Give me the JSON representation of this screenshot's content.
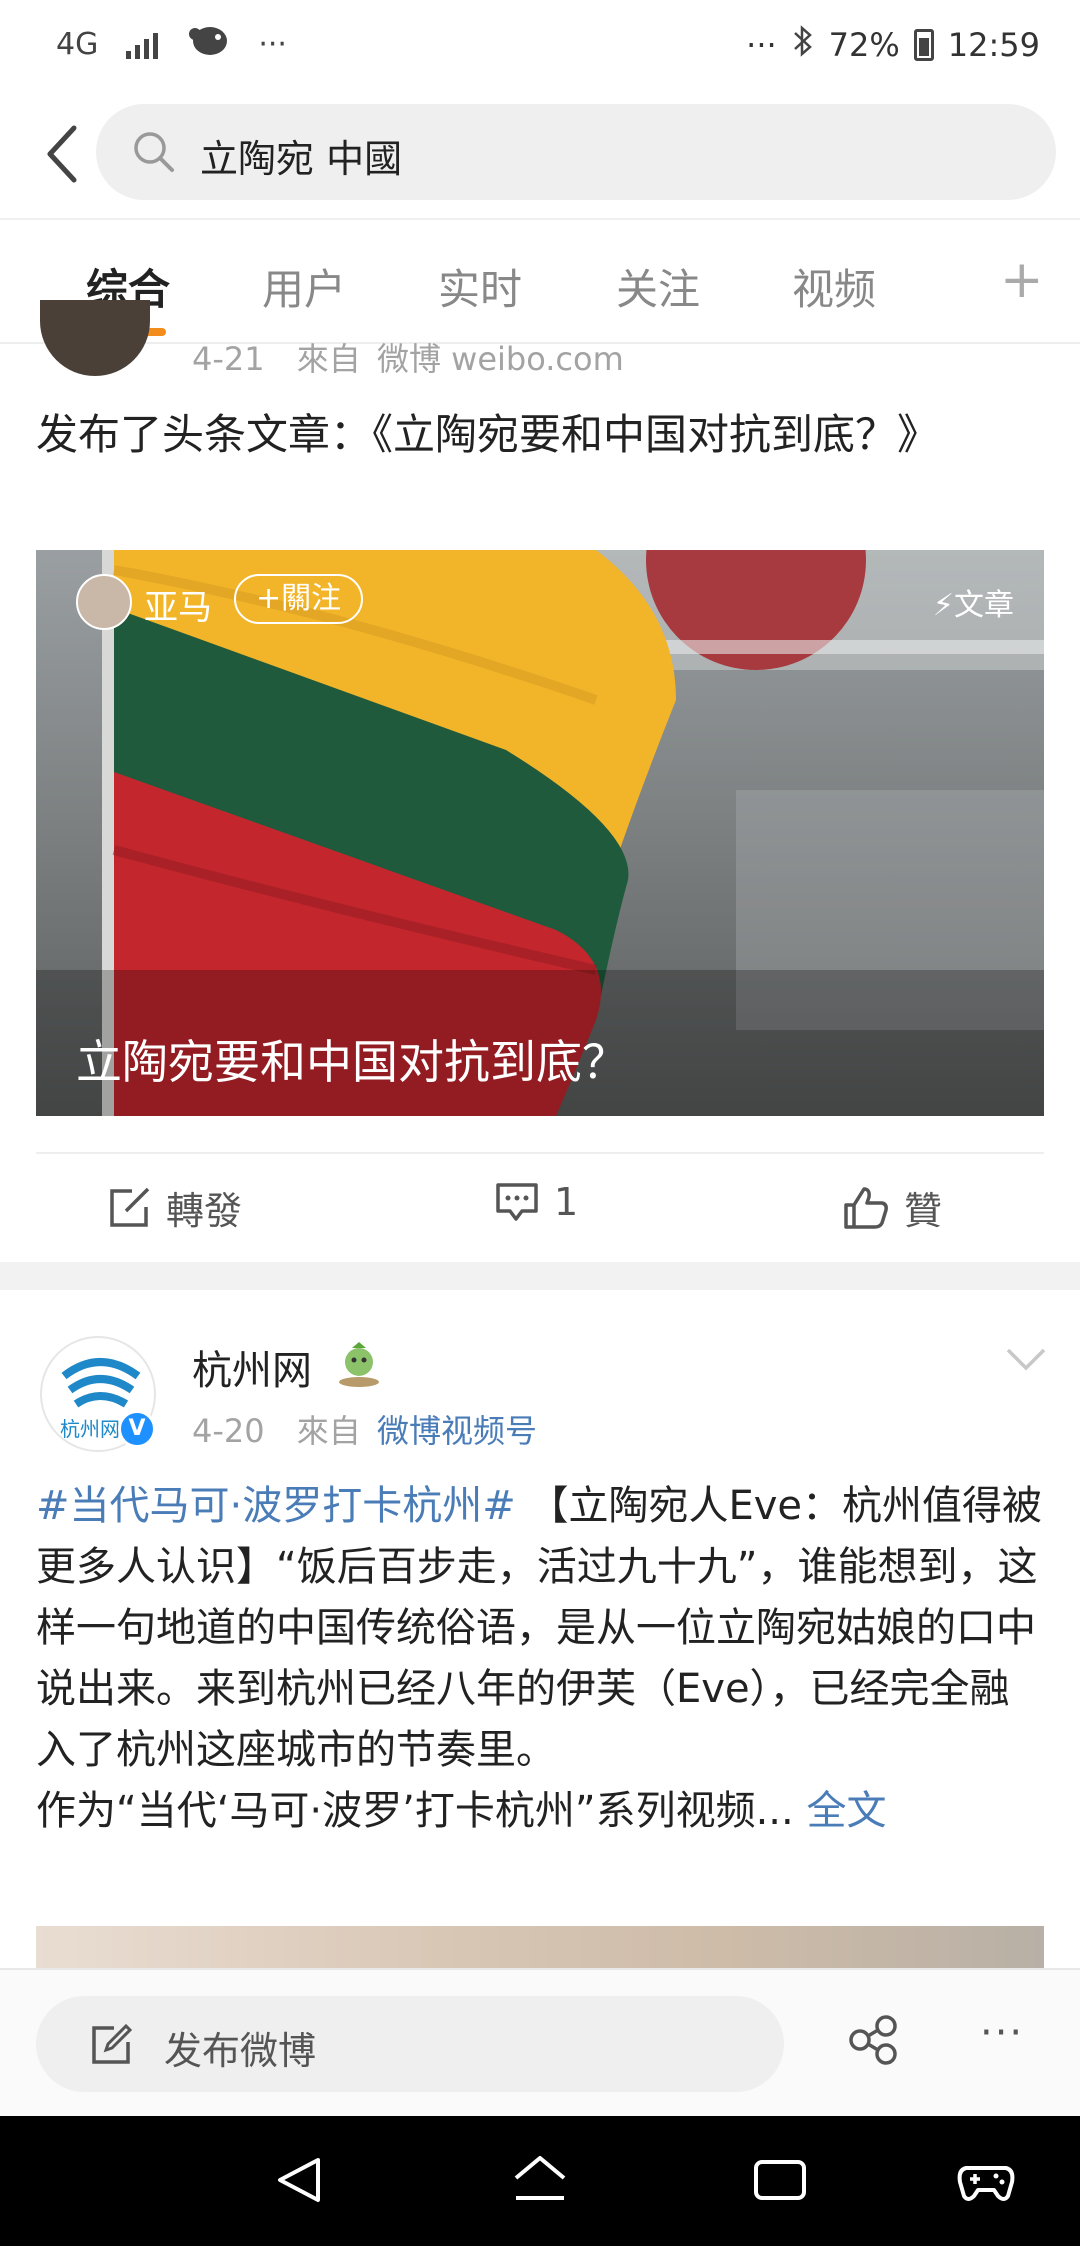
{
  "status_bar": {
    "network": "4G",
    "dots_left": "···",
    "dots_right": "···",
    "battery": "72%",
    "time": "12:59"
  },
  "search": {
    "query": "立陶宛 中國"
  },
  "tabs": [
    {
      "label": "综合",
      "active": true
    },
    {
      "label": "用户",
      "active": false
    },
    {
      "label": "实时",
      "active": false
    },
    {
      "label": "关注",
      "active": false
    },
    {
      "label": "视频",
      "active": false
    }
  ],
  "tab_more": "+",
  "post1": {
    "date": "4-21",
    "from": "來自",
    "source": "微博 weibo.com",
    "text": "发布了头条文章：《立陶宛要和中国对抗到底？》",
    "card": {
      "author": "亚马",
      "follow": "+關注",
      "type": "文章",
      "title": "立陶宛要和中国对抗到底？",
      "flag_colors": [
        "#f2b52a",
        "#1f5a3c",
        "#c3262c"
      ]
    },
    "actions": {
      "repost": "轉發",
      "comment_count": "1",
      "like": "贊"
    }
  },
  "post2": {
    "name": "杭州网",
    "avatar_text": "杭州网",
    "date": "4-20",
    "from": "來自",
    "source": "微博视频号",
    "hashtag": "#当代马可·波罗打卡杭州#",
    "body": " 【立陶宛人Eve：杭州值得被更多人认识】“饭后百步走，活过九十九”，谁能想到，这样一句地道的中国传统俗语，是从一位立陶宛姑娘的口中说出来。来到杭州已经八年的伊芙（Eve），已经完全融入了杭州这座城市的节奏里。",
    "body2": "作为“当代‘马可·波罗’打卡杭州”系列视频...",
    "fulltext": "全文"
  },
  "compose": {
    "placeholder": "发布微博",
    "more": "···"
  }
}
